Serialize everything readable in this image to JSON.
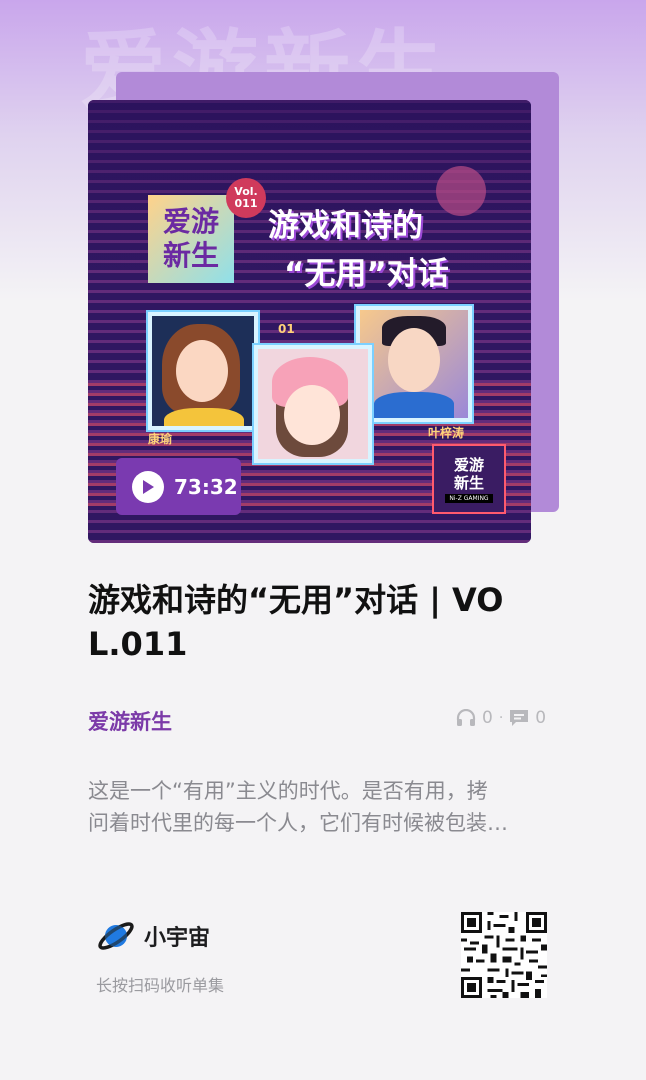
{
  "background_watermark": "爱游新生",
  "cover": {
    "badge_line1": "爱游",
    "badge_line2": "新生",
    "vol_line1": "Vol.",
    "vol_line2": "011",
    "title_line1": "游戏和诗的",
    "title_line2": "“无用”对话",
    "guest_left": "康瑜",
    "guest_center": "01",
    "guest_right": "叶梓涛",
    "mini_logo_line1": "爱游",
    "mini_logo_line2": "新生",
    "mini_logo_tag": "Ni-Z GAMING",
    "duration": "73:32",
    "accent": "#7a3ab0"
  },
  "episode": {
    "title": "游戏和诗的“无用”对话 | VOL.011",
    "podcast_name": "爱游新生",
    "listen_count": "0",
    "comment_count": "0",
    "description_line1": "这是一个“有用”主义的时代。是否有用，拷",
    "description_line2": "问着时代里的每一个人，它们有时候被包装…"
  },
  "footer": {
    "brand_name": "小宇宙",
    "scan_hint": "长按扫码收听单集",
    "icons": [
      "planet-logo-icon",
      "qr-code"
    ]
  },
  "colors": {
    "purple_text": "#7b3aa8",
    "gray_text": "#8a8a90",
    "background": "#f4f3f5"
  }
}
